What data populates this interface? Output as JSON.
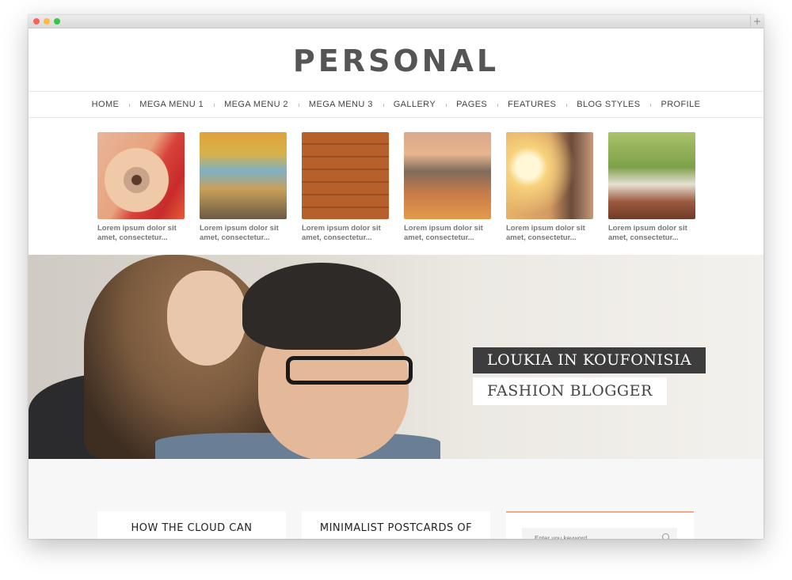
{
  "site": {
    "logo": "PERSONAL",
    "nav": [
      "HOME",
      "MEGA MENU 1",
      "MEGA MENU 2",
      "MEGA MENU 3",
      "GALLERY",
      "PAGES",
      "FEATURES",
      "BLOG STYLES",
      "PROFILE"
    ]
  },
  "thumbnails": [
    {
      "caption": "Lorem ipsum dolor sit amet, consectetur...",
      "icon": "eye-closeup-photo"
    },
    {
      "caption": "Lorem ipsum dolor sit amet, consectetur...",
      "icon": "city-painting-photo"
    },
    {
      "caption": "Lorem ipsum dolor sit amet, consectetur...",
      "icon": "guitar-on-wood-photo"
    },
    {
      "caption": "Lorem ipsum dolor sit amet, consectetur...",
      "icon": "coast-sunset-photo"
    },
    {
      "caption": "Lorem ipsum dolor sit amet, consectetur...",
      "icon": "couple-sunset-photo"
    },
    {
      "caption": "Lorem ipsum dolor sit amet, consectetur...",
      "icon": "couple-bench-photo"
    }
  ],
  "hero": {
    "title": "LOUKIA IN KOUFONISIA",
    "subtitle": "FASHION BLOGGER"
  },
  "posts": [
    {
      "title": "HOW THE CLOUD CAN"
    },
    {
      "title": "MINIMALIST POSTCARDS OF"
    }
  ],
  "search": {
    "placeholder": "Enter you keyword"
  },
  "colors": {
    "accent": "#f0a98a",
    "hero_label_bg": "#3d3d3d"
  }
}
